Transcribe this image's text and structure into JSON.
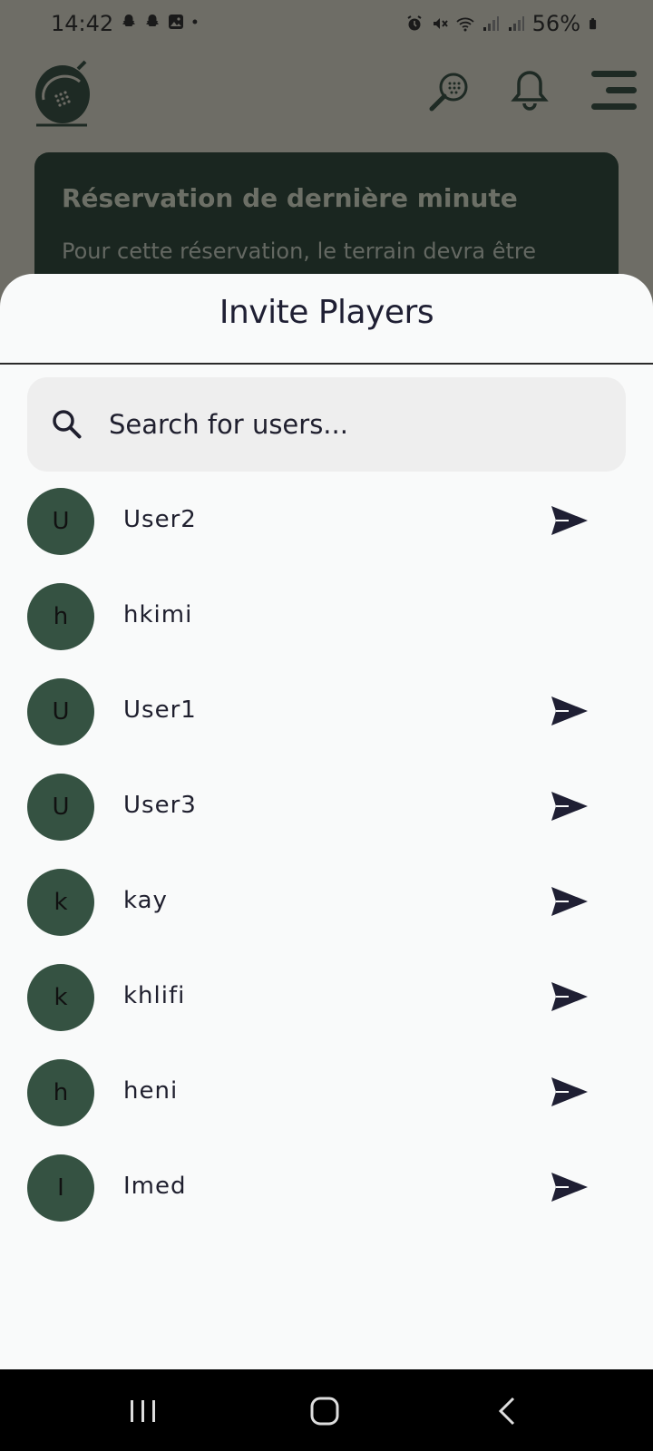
{
  "status": {
    "time": "14:42",
    "battery": "56%",
    "left_icons": [
      "snapchat-icon",
      "snapchat-icon",
      "gallery-icon",
      "dot-icon"
    ],
    "right_icons": [
      "alarm-icon",
      "mute-icon",
      "wifi-icon",
      "signal-icon",
      "signal-icon",
      "battery-icon"
    ]
  },
  "banner": {
    "title": "Réservation de dernière minute",
    "body": "Pour cette réservation, le terrain devra être"
  },
  "sheet": {
    "title": "Invite Players",
    "search_placeholder": "Search for users..."
  },
  "users": [
    {
      "initial": "U",
      "name": "User2",
      "can_invite": true
    },
    {
      "initial": "h",
      "name": "hkimi",
      "can_invite": false
    },
    {
      "initial": "U",
      "name": "User1",
      "can_invite": true
    },
    {
      "initial": "U",
      "name": "User3",
      "can_invite": true
    },
    {
      "initial": "k",
      "name": "kay",
      "can_invite": true
    },
    {
      "initial": "k",
      "name": "khlifi",
      "can_invite": true
    },
    {
      "initial": "h",
      "name": "heni",
      "can_invite": true
    },
    {
      "initial": "I",
      "name": "Imed",
      "can_invite": true
    }
  ],
  "colors": {
    "avatar_bg": "#355242",
    "scrim": "#6e6d66",
    "sheet_bg": "#f9fafa",
    "accent_dark": "#1f1f2e"
  }
}
